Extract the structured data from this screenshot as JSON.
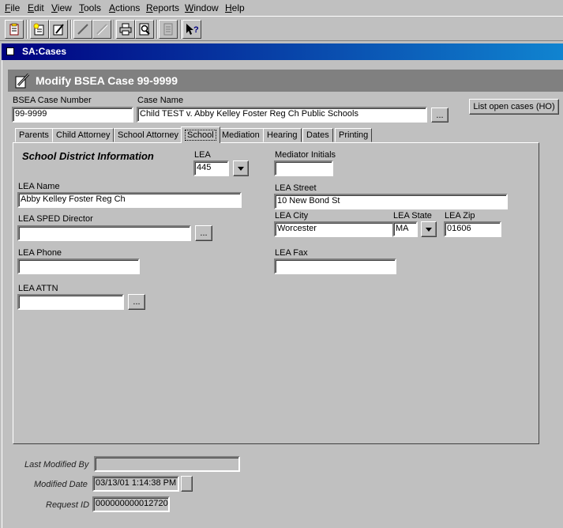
{
  "menu": [
    "File",
    "Edit",
    "View",
    "Tools",
    "Actions",
    "Reports",
    "Window",
    "Help"
  ],
  "toolbar_icons": [
    "clipboard-icon",
    "new-record-icon",
    "edit-record-icon",
    "pencil-icon",
    "pencil-disabled-icon",
    "print-icon",
    "print-preview-icon",
    "document-icon",
    "help-cursor-icon"
  ],
  "window": {
    "title": "SA:Cases"
  },
  "header": {
    "title": "Modify BSEA Case 99-9999"
  },
  "case": {
    "number_label": "BSEA Case Number",
    "number_value": "99-9999",
    "name_label": "Case Name",
    "name_value": "Child TEST v. Abby Kelley Foster Reg Ch Public Schools",
    "browse_label": "...",
    "list_open_label": "List open cases (HO)"
  },
  "tabs": [
    "Parents",
    "Child Attorney",
    "School Attorney",
    "School",
    "Mediation",
    "Hearing",
    "Dates",
    "Printing"
  ],
  "active_tab": "School",
  "school": {
    "section_title": "School District Information",
    "lea_label": "LEA",
    "lea_value": "445",
    "mediator_initials_label": "Mediator Initials",
    "mediator_initials_value": "",
    "lea_name_label": "LEA Name",
    "lea_name_value": "Abby Kelley Foster Reg Ch",
    "lea_street_label": "LEA Street",
    "lea_street_value": "10 New Bond St",
    "lea_sped_label": "LEA SPED Director",
    "lea_sped_value": "",
    "lea_city_label": "LEA City",
    "lea_city_value": "Worcester",
    "lea_state_label": "LEA State",
    "lea_state_value": "MA",
    "lea_zip_label": "LEA Zip",
    "lea_zip_value": "01606",
    "lea_phone_label": "LEA Phone",
    "lea_phone_value": "",
    "lea_fax_label": "LEA Fax",
    "lea_fax_value": "",
    "lea_attn_label": "LEA ATTN",
    "lea_attn_value": "",
    "browse_label": "..."
  },
  "footer": {
    "last_modified_by_label": "Last Modified By",
    "last_modified_by_value": "",
    "modified_date_label": "Modified Date",
    "modified_date_value": "03/13/01 1:14:38 PM",
    "request_id_label": "Request ID",
    "request_id_value": "000000000012720"
  },
  "colors": {
    "titlebar_start": "#000080",
    "titlebar_end": "#1084d0",
    "header_band": "#808080",
    "face": "#c0c0c0"
  }
}
